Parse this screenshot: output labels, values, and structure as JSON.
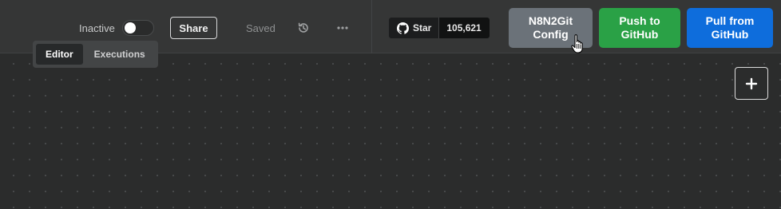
{
  "header": {
    "active_label": "Inactive",
    "active_state": false,
    "share_label": "Share",
    "saved_label": "Saved",
    "history_icon": "history-icon",
    "more_icon": "more-horizontal-icon"
  },
  "github_star": {
    "icon": "github-icon",
    "label": "Star",
    "count": "105,621"
  },
  "actions": {
    "config_label": "N8N2Git Config",
    "push_label": "Push to GitHub",
    "pull_label": "Pull from GitHub",
    "config_color": "#6b7279",
    "push_color": "#2aa146",
    "pull_color": "#0e6ddc"
  },
  "tabs": [
    {
      "label": "Editor",
      "active": true
    },
    {
      "label": "Executions",
      "active": false
    }
  ],
  "canvas": {
    "add_icon": "plus-icon"
  }
}
